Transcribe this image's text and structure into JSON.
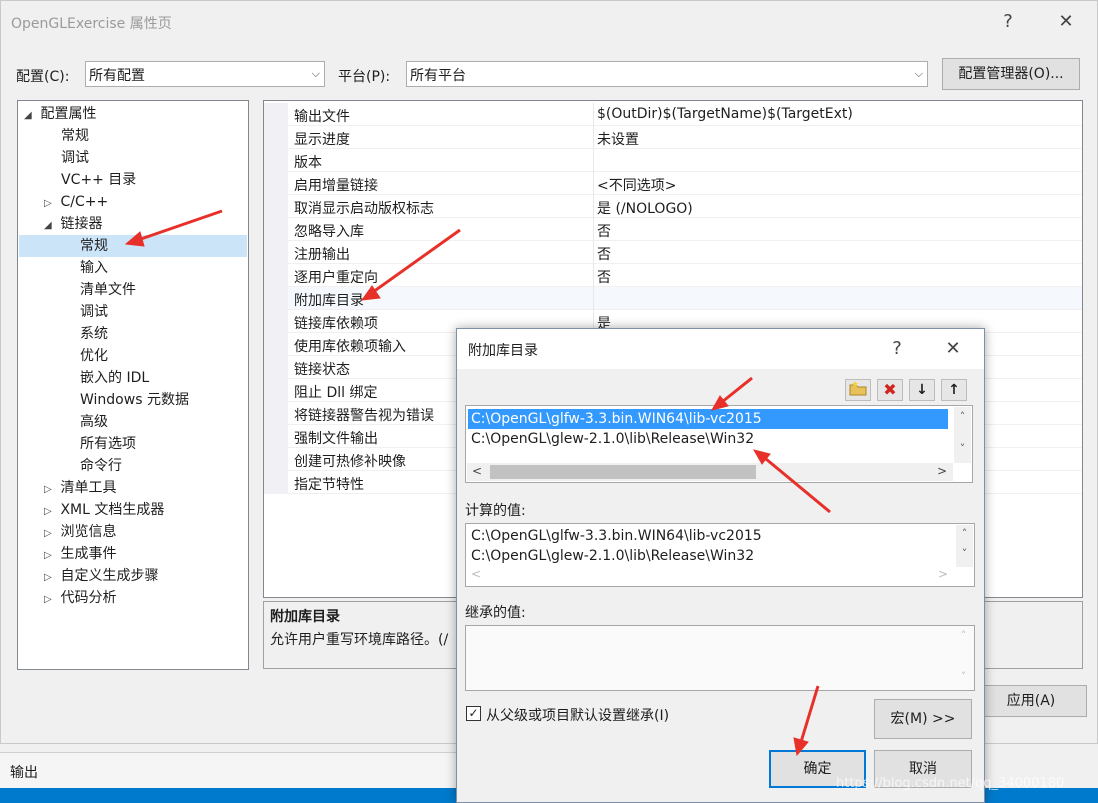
{
  "window": {
    "title": "OpenGLExercise 属性页",
    "help": "?",
    "close": "✕"
  },
  "config": {
    "config_label": "配置(C):",
    "config_value": "所有配置",
    "platform_label": "平台(P):",
    "platform_value": "所有平台",
    "manager_button": "配置管理器(O)..."
  },
  "tree": {
    "root": "配置属性",
    "items": [
      {
        "label": "常规"
      },
      {
        "label": "调试"
      },
      {
        "label": "VC++ 目录"
      },
      {
        "label": "C/C++"
      },
      {
        "label": "链接器"
      },
      {
        "label": "常规"
      },
      {
        "label": "输入"
      },
      {
        "label": "清单文件"
      },
      {
        "label": "调试"
      },
      {
        "label": "系统"
      },
      {
        "label": "优化"
      },
      {
        "label": "嵌入的 IDL"
      },
      {
        "label": "Windows 元数据"
      },
      {
        "label": "高级"
      },
      {
        "label": "所有选项"
      },
      {
        "label": "命令行"
      },
      {
        "label": "清单工具"
      },
      {
        "label": "XML 文档生成器"
      },
      {
        "label": "浏览信息"
      },
      {
        "label": "生成事件"
      },
      {
        "label": "自定义生成步骤"
      },
      {
        "label": "代码分析"
      }
    ]
  },
  "grid": {
    "rows": [
      {
        "name": "输出文件",
        "value": "$(OutDir)$(TargetName)$(TargetExt)"
      },
      {
        "name": "显示进度",
        "value": "未设置"
      },
      {
        "name": "版本",
        "value": ""
      },
      {
        "name": "启用增量链接",
        "value": "<不同选项>"
      },
      {
        "name": "取消显示启动版权标志",
        "value": "是 (/NOLOGO)"
      },
      {
        "name": "忽略导入库",
        "value": "否"
      },
      {
        "name": "注册输出",
        "value": "否"
      },
      {
        "name": "逐用户重定向",
        "value": "否"
      },
      {
        "name": "附加库目录",
        "value": ""
      },
      {
        "name": "链接库依赖项",
        "value": "是"
      },
      {
        "name": "使用库依赖项输入",
        "value": ""
      },
      {
        "name": "链接状态",
        "value": ""
      },
      {
        "name": "阻止 Dll 绑定",
        "value": ""
      },
      {
        "name": "将链接器警告视为错误",
        "value": ""
      },
      {
        "name": "强制文件输出",
        "value": ""
      },
      {
        "name": "创建可热修补映像",
        "value": ""
      },
      {
        "name": "指定节特性",
        "value": ""
      }
    ],
    "desc_title": "附加库目录",
    "desc_text": "允许用户重写环境库路径。(/"
  },
  "main_buttons": {
    "apply": "应用(A)"
  },
  "dialog": {
    "title": "附加库目录",
    "help": "?",
    "close": "✕",
    "entries": [
      "C:\\OpenGL\\glfw-3.3.bin.WIN64\\lib-vc2015",
      "C:\\OpenGL\\glew-2.1.0\\lib\\Release\\Win32"
    ],
    "evaluated_label": "计算的值:",
    "evaluated": [
      "C:\\OpenGL\\glfw-3.3.bin.WIN64\\lib-vc2015",
      "C:\\OpenGL\\glew-2.1.0\\lib\\Release\\Win32"
    ],
    "inherited_label": "继承的值:",
    "inherit_checkbox": "从父级或项目默认设置继承(I)",
    "macro_button": "宏(M) >>",
    "ok_button": "确定",
    "cancel_button": "取消"
  },
  "output": {
    "label": "输出"
  },
  "watermark": "https://blog.csdn.net/qq_34000180",
  "colors": {
    "selection": "#3399ff",
    "tree_selection": "#cce4f7",
    "annotation_arrow": "#e8302a"
  },
  "icons": {
    "new_line": "folder-star-icon",
    "delete": "red-x-icon",
    "move_down": "arrow-down-icon",
    "move_up": "arrow-up-icon"
  }
}
